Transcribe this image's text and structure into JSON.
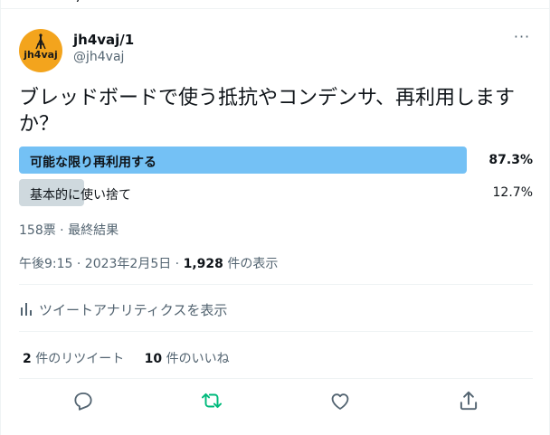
{
  "top_fragment": "ノ",
  "author": {
    "avatar_text": "jh4vaj",
    "display_name": "jh4vaj/1",
    "handle": "@jh4vaj"
  },
  "more_label": "···",
  "question": "ブレッドボードで使う抵抗やコンデンサ、再利用しますか？",
  "poll": {
    "options": [
      {
        "label": "可能な限り再利用する",
        "percent": "87.3%",
        "value": 87.3,
        "winner": true
      },
      {
        "label": "基本的に使い捨て",
        "percent": "12.7%",
        "value": 12.7,
        "winner": false
      }
    ],
    "meta": "158票 · 最終結果"
  },
  "timestamp": {
    "text": "午後9:15 · 2023年2月5日 · ",
    "views_count": "1,928",
    "views_label": " 件の表示"
  },
  "analytics_label": "ツイートアナリティクスを表示",
  "stats": {
    "retweets_count": "2",
    "retweets_label": " 件のリツイート",
    "likes_count": "10",
    "likes_label": " 件のいいね"
  },
  "actions": {
    "icons": [
      "reply-icon",
      "retweet-icon",
      "like-icon",
      "share-icon"
    ]
  },
  "colors": {
    "poll_winner": "#74c1f5",
    "poll_other": "#cfd9de",
    "retweet_accent": "#00ba7c",
    "secondary_text": "#536471",
    "avatar_bg": "#f3a41d"
  }
}
